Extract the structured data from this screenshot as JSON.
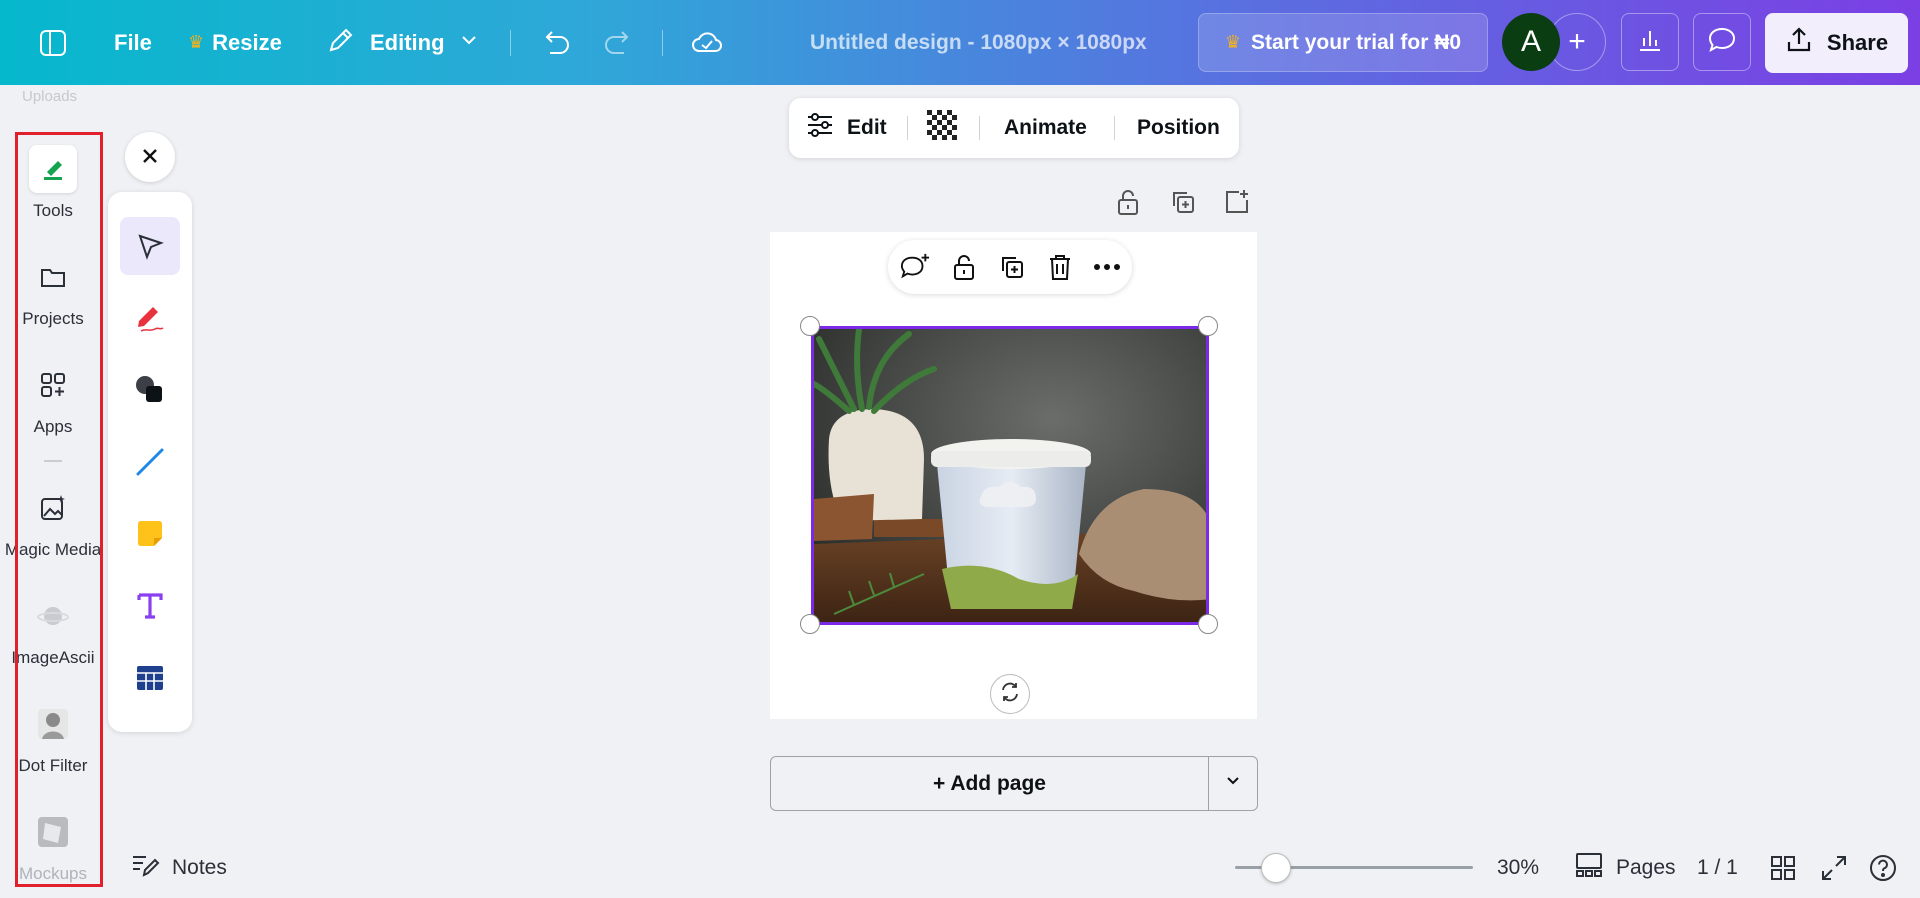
{
  "topbar": {
    "file_label": "File",
    "resize_label": "Resize",
    "editing_label": "Editing",
    "title": "Untitled design - 1080px × 1080px",
    "trial_label": "Start your trial for ₦0",
    "avatar_initial": "A",
    "share_label": "Share",
    "accent_color": "#7d2ae8"
  },
  "rail": {
    "faded_label": "Uploads",
    "items": [
      {
        "label": "Tools",
        "icon": "tools-icon"
      },
      {
        "label": "Projects",
        "icon": "folder-icon"
      },
      {
        "label": "Apps",
        "icon": "apps-icon"
      },
      {
        "label": "Magic Media",
        "icon": "magic-media-icon"
      },
      {
        "label": "ImageAscii",
        "icon": "imageascii-icon"
      },
      {
        "label": "Dot Filter",
        "icon": "dot-filter-icon"
      },
      {
        "label": "Mockups",
        "icon": "mockups-icon"
      }
    ]
  },
  "tools": [
    "select-pointer-icon",
    "pen-draw-icon",
    "shapes-icon",
    "line-icon",
    "sticky-note-icon",
    "text-icon",
    "table-icon"
  ],
  "context_bar": {
    "edit_label": "Edit",
    "animate_label": "Animate",
    "position_label": "Position"
  },
  "canvas": {
    "add_page_label": "+ Add page"
  },
  "bottom": {
    "notes_label": "Notes",
    "zoom_percent": 30,
    "zoom_label": "30%",
    "pages_label": "Pages",
    "page_count": "1 / 1"
  }
}
